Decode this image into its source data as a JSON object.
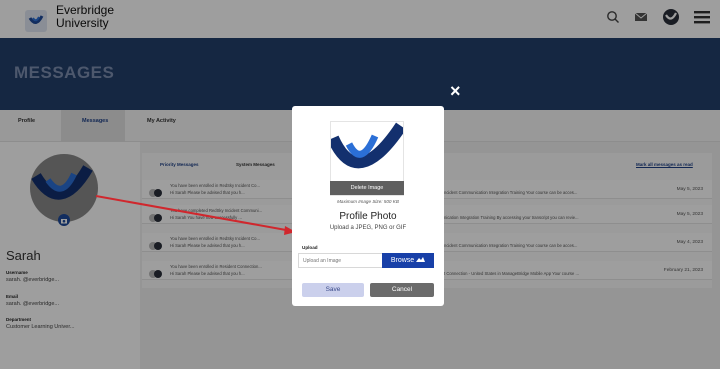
{
  "header": {
    "logo_line1": "Everbridge",
    "logo_line2": "University",
    "icons": [
      "search-icon",
      "mail-icon",
      "globe-icon",
      "menu-icon"
    ]
  },
  "hero": {
    "title": "MESSAGES"
  },
  "tabs": {
    "profile": "Profile",
    "messages": "Messages",
    "activity": "My Activity"
  },
  "profile": {
    "name": "Sarah",
    "username_label": "Username",
    "username_value": "sarah.        @everbridge...",
    "email_label": "Email",
    "email_value": "sarah.        @everbridge...",
    "department_label": "Department",
    "department_value": "Customer Learning Univer..."
  },
  "messages": {
    "priority_tab": "Priority Messages",
    "system_tab": "System Messages",
    "mark_all": "Mark all messages as read",
    "rows": [
      {
        "line1": "You have been enrolled in RedSky Incident Co...",
        "line2": "Hi Sarah        Please be advised that you h...",
        "right": "ncident Communication Integration Training Your course can be acces...",
        "date": "May 5, 2023"
      },
      {
        "line1": "You have completed RedSky Incident Communi...",
        "line2": "Hi Sarah         You have now successfully ...",
        "right": "nication Integration Training By accessing your transcript you can revie...",
        "date": "May 5, 2023"
      },
      {
        "line1": "You have been enrolled in RedSky Incident Co...",
        "line2": "Hi Sarah        Please be advised that you h...",
        "right": "ncident Communication Integration Training Your course can be acces...",
        "date": "May 4, 2023"
      },
      {
        "line1": "You have been enrolled in Resident Connection...",
        "line2": "Hi Sarah        Please be advised that you h...",
        "right": "t Connection - United States in ManageBridge Mobile App Your course ...",
        "date": "February 21, 2023"
      }
    ]
  },
  "modal": {
    "close": "×",
    "delete_image": "Delete Image",
    "max_size": "Maximum Image Size: 500 KB",
    "title": "Profile Photo",
    "subtitle": "Upload a JPEG, PNG or GIF",
    "upload_label": "Upload",
    "upload_placeholder": "Upload an Image",
    "browse": "Browse",
    "save": "Save",
    "cancel": "Cancel"
  },
  "colors": {
    "brand_navy": "#223f6b",
    "accent_blue": "#1840a8",
    "arrow_red": "#d0272d"
  }
}
